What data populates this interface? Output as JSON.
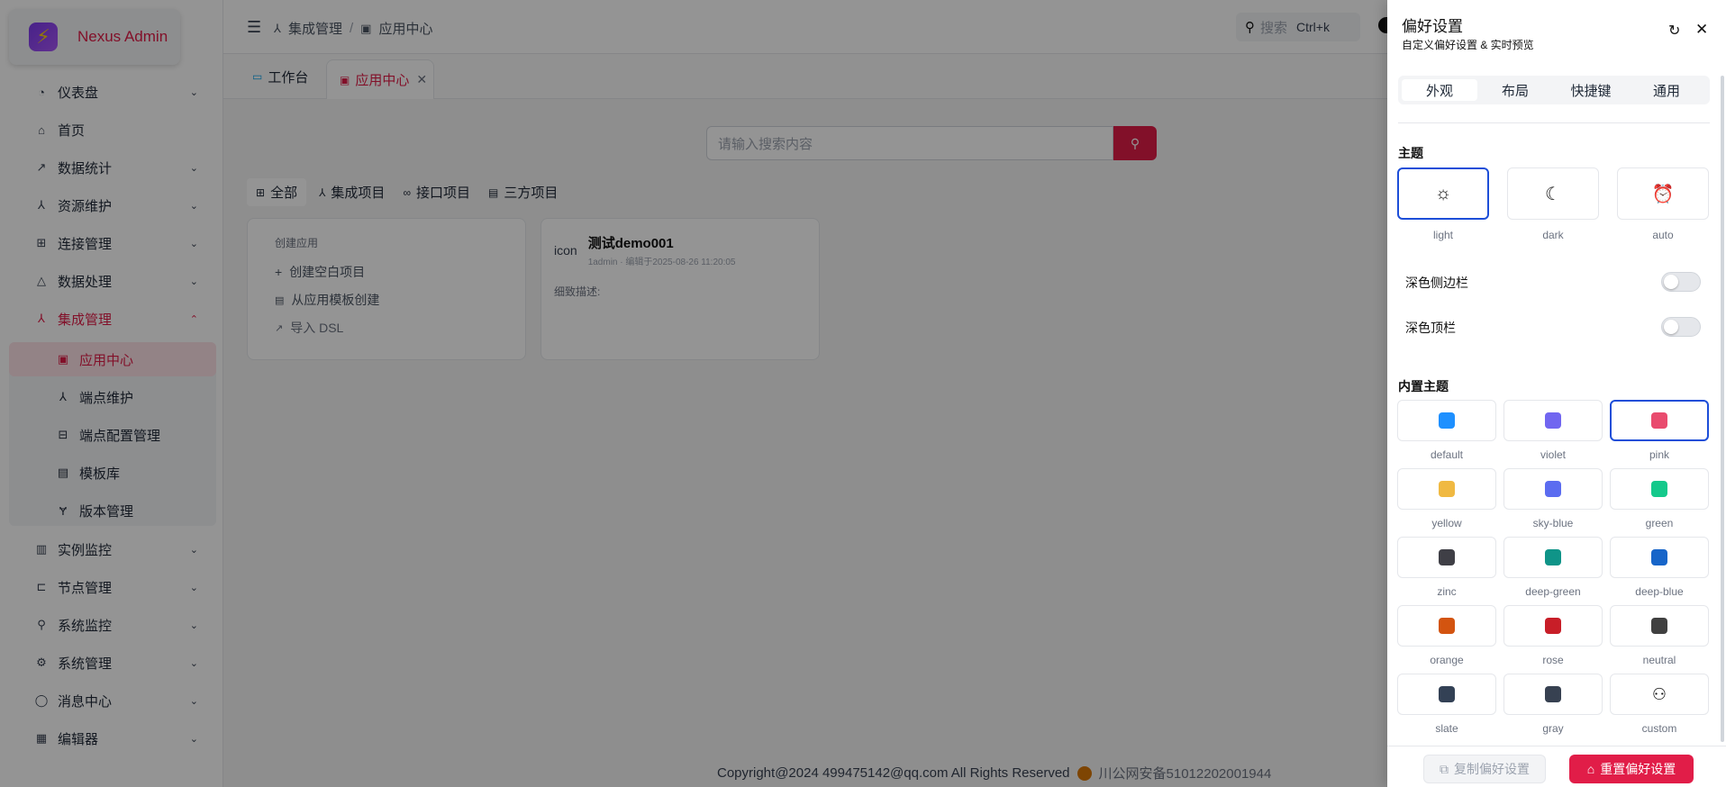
{
  "app": {
    "name": "Nexus Admin"
  },
  "sidebar": {
    "items": [
      {
        "label": "仪表盘",
        "icon": "dashboard-icon",
        "chevron": "down"
      },
      {
        "label": "首页",
        "icon": "home-icon",
        "chevron": ""
      },
      {
        "label": "数据统计",
        "icon": "chart-line-icon",
        "chevron": "down"
      },
      {
        "label": "资源维护",
        "icon": "network-icon",
        "chevron": "down"
      },
      {
        "label": "连接管理",
        "icon": "sitemap-icon",
        "chevron": "down"
      },
      {
        "label": "数据处理",
        "icon": "triangle-icon",
        "chevron": "down"
      },
      {
        "label": "集成管理",
        "icon": "integration-icon",
        "chevron": "up"
      }
    ],
    "sub_items": [
      {
        "label": "应用中心",
        "icon": "app-icon"
      },
      {
        "label": "端点维护",
        "icon": "endpoint-icon"
      },
      {
        "label": "端点配置管理",
        "icon": "config-icon"
      },
      {
        "label": "模板库",
        "icon": "file-icon"
      },
      {
        "label": "版本管理",
        "icon": "branch-icon"
      }
    ],
    "items_after": [
      {
        "label": "实例监控",
        "icon": "bar-chart-icon"
      },
      {
        "label": "节点管理",
        "icon": "node-icon"
      },
      {
        "label": "系统监控",
        "icon": "monitor-icon"
      },
      {
        "label": "系统管理",
        "icon": "gear-icon"
      },
      {
        "label": "消息中心",
        "icon": "message-icon"
      },
      {
        "label": "编辑器",
        "icon": "editor-icon"
      }
    ]
  },
  "header": {
    "breadcrumb": [
      "集成管理",
      "应用中心"
    ],
    "breadcrumb_sep": "/",
    "search_placeholder": "搜索",
    "search_shortcut": "Ctrl+k"
  },
  "tabs": [
    {
      "label": "工作台",
      "active": false
    },
    {
      "label": "应用中心",
      "active": true
    }
  ],
  "main": {
    "search_placeholder": "请输入搜索内容",
    "filters": [
      "全部",
      "集成项目",
      "接口项目",
      "三方项目"
    ],
    "create_card": {
      "title": "创建应用",
      "actions": [
        "创建空白项目",
        "从应用模板创建",
        "导入 DSL"
      ]
    },
    "app_card": {
      "icon_text": "icon",
      "name": "测试demo001",
      "meta": "1admin · 编辑于2025-08-26 11:20:05",
      "desc_label": "细致描述:"
    },
    "footer": {
      "copyright": "Copyright@2024 499475142@qq.com All Rights Reserved",
      "icp": "川公网安备51012202001944"
    }
  },
  "panel": {
    "title": "偏好设置",
    "subtitle": "自定义偏好设置 & 实时预览",
    "tabs": [
      "外观",
      "布局",
      "快捷键",
      "通用"
    ],
    "theme_section": "主题",
    "modes": [
      {
        "label": "light",
        "icon": "sun-icon"
      },
      {
        "label": "dark",
        "icon": "moon-icon"
      },
      {
        "label": "auto",
        "icon": "alarm-icon"
      }
    ],
    "toggles": [
      {
        "label": "深色侧边栏",
        "on": false
      },
      {
        "label": "深色顶栏",
        "on": false
      }
    ],
    "builtin_section": "内置主题",
    "themes": [
      {
        "label": "default",
        "color": "#1e90ff"
      },
      {
        "label": "violet",
        "color": "#7166f0"
      },
      {
        "label": "pink",
        "color": "#e94b6e"
      },
      {
        "label": "yellow",
        "color": "#f0b942"
      },
      {
        "label": "sky-blue",
        "color": "#5b6cf0"
      },
      {
        "label": "green",
        "color": "#14c98b"
      },
      {
        "label": "zinc",
        "color": "#3f3f46"
      },
      {
        "label": "deep-green",
        "color": "#0f9488"
      },
      {
        "label": "deep-blue",
        "color": "#1765c9"
      },
      {
        "label": "orange",
        "color": "#d35410"
      },
      {
        "label": "rose",
        "color": "#c81e28"
      },
      {
        "label": "neutral",
        "color": "#404040"
      },
      {
        "label": "slate",
        "color": "#334155"
      },
      {
        "label": "gray",
        "color": "#374151"
      },
      {
        "label": "custom",
        "color": ""
      }
    ],
    "copy_button": "复制偏好设置",
    "reset_button": "重置偏好设置"
  },
  "colors": {
    "accent": "#e11d48",
    "selected_border": "#1d4ed8"
  }
}
